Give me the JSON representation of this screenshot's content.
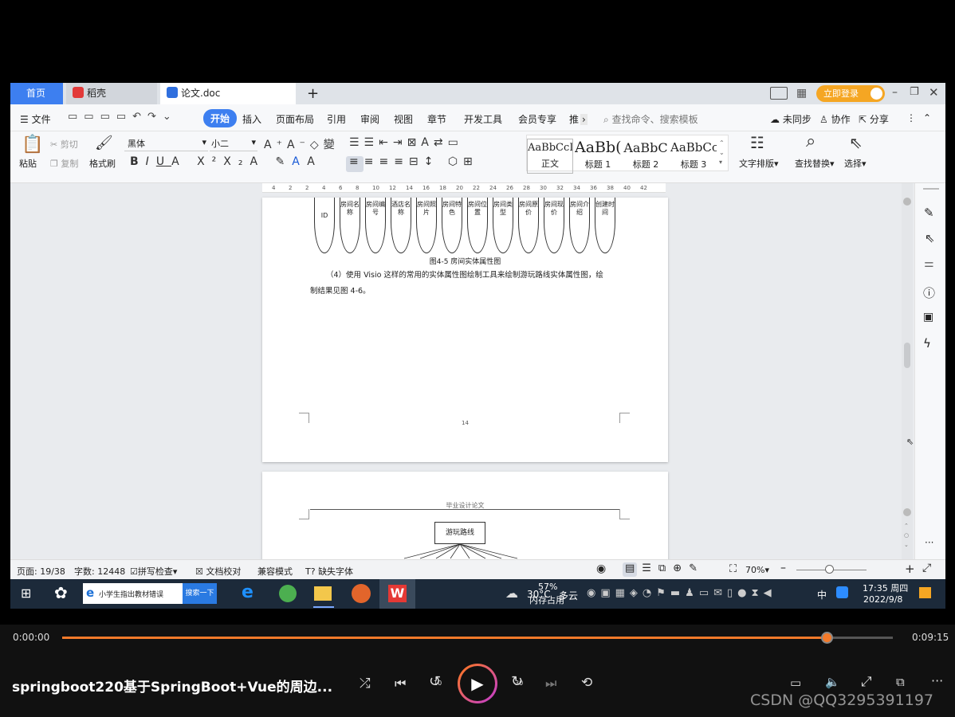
{
  "tabs": {
    "home": "首页",
    "daoke": "稻壳",
    "doc": "论文.doc",
    "add": "+"
  },
  "title_right": {
    "login": "立即登录"
  },
  "menu": {
    "file": "文件",
    "start": "开始",
    "items": [
      "插入",
      "页面布局",
      "引用",
      "审阅",
      "视图",
      "章节",
      "开发工具",
      "会员专享",
      "推"
    ],
    "search": "查找命令、搜索模板",
    "sync": "未同步",
    "collab": "协作",
    "share": "分享"
  },
  "ribbon": {
    "paste": "粘贴",
    "cut": "剪切",
    "copy": "复制",
    "format_painter": "格式刷",
    "font": "黑体",
    "size": "小二",
    "styles": [
      {
        "preview": "AaBbCcI",
        "label": "正文"
      },
      {
        "preview": "AaBb(",
        "label": "标题 1"
      },
      {
        "preview": "AaBbC",
        "label": "标题 2"
      },
      {
        "preview": "AaBbCc",
        "label": "标题 3"
      }
    ],
    "text_layout": "文字排版",
    "find_replace": "查找替换",
    "select": "选择"
  },
  "ruler": [
    "4",
    "2",
    "2",
    "4",
    "6",
    "8",
    "10",
    "12",
    "14",
    "16",
    "18",
    "20",
    "22",
    "24",
    "26",
    "28",
    "30",
    "32",
    "34",
    "36",
    "38",
    "40",
    "42"
  ],
  "page1": {
    "attrs": [
      "ID",
      "房间名称",
      "房间编号",
      "酒店名称",
      "房间照片",
      "房间特色",
      "房间位置",
      "房间类型",
      "房间原价",
      "房间现价",
      "房间介绍",
      "创建时间"
    ],
    "caption": "图4-5 房间实体属性图",
    "para_line1": "（4）使用 Visio 这样的常用的实体属性图绘制工具来绘制游玩路线实体属性图，绘",
    "para_line2": "制结果见图 4-6。",
    "page_no": "14"
  },
  "page2": {
    "header": "毕业设计论文",
    "entity": "游玩路线"
  },
  "status": {
    "page": "页面: 19/38",
    "words": "字数: 12448",
    "spell": "拼写检查",
    "proof": "文档校对",
    "compat": "兼容模式",
    "missing_font": "缺失字体",
    "zoom": "70%"
  },
  "taskbar": {
    "search_text": "小学生指出教材错误",
    "search_btn": "搜索一下",
    "weather_temp": "30°C",
    "weather": "多云",
    "mem_pct": "57%",
    "mem_label": "内存占用",
    "ime": "中",
    "time": "17:35 周四",
    "date": "2022/9/8"
  },
  "player": {
    "elapsed": "0:00:00",
    "total": "0:09:15",
    "progress": 0.92,
    "title": "springboot220基于SpringBoot+Vue的周边...",
    "skip_back": "10",
    "skip_fwd": "30",
    "watermark": "CSDN @QQ3295391197"
  }
}
